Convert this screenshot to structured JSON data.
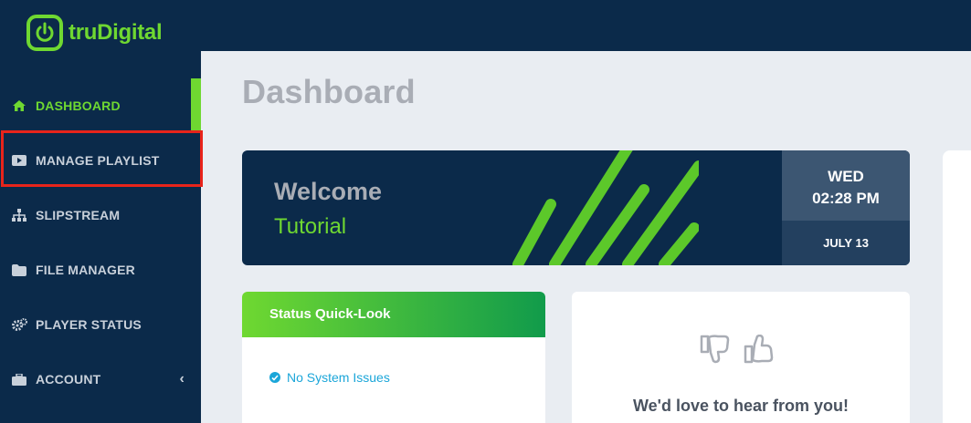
{
  "brand": {
    "name": "truDigital",
    "accent": "#6fd831",
    "navy": "#0b2a4a"
  },
  "sidebar": {
    "items": [
      {
        "label": "DASHBOARD",
        "icon": "home-icon",
        "active": true
      },
      {
        "label": "MANAGE PLAYLIST",
        "icon": "play-icon",
        "active": false
      },
      {
        "label": "SLIPSTREAM",
        "icon": "sitemap-icon",
        "active": false
      },
      {
        "label": "FILE MANAGER",
        "icon": "folder-icon",
        "active": false
      },
      {
        "label": "PLAYER STATUS",
        "icon": "gears-icon",
        "active": false
      },
      {
        "label": "ACCOUNT",
        "icon": "briefcase-icon",
        "active": false,
        "expand_icon": "chevron-left-icon"
      }
    ]
  },
  "main": {
    "title": "Dashboard",
    "welcome": {
      "title": "Welcome",
      "subtitle": "Tutorial",
      "day": "WED",
      "time": "02:28 PM",
      "date": "JULY 13"
    },
    "status": {
      "header": "Status Quick-Look",
      "message": "No System Issues",
      "icon": "check-circle-icon"
    },
    "feedback": {
      "text": "We'd love to hear from you!",
      "icons": [
        "thumbs-down-icon",
        "thumbs-up-icon"
      ]
    }
  }
}
